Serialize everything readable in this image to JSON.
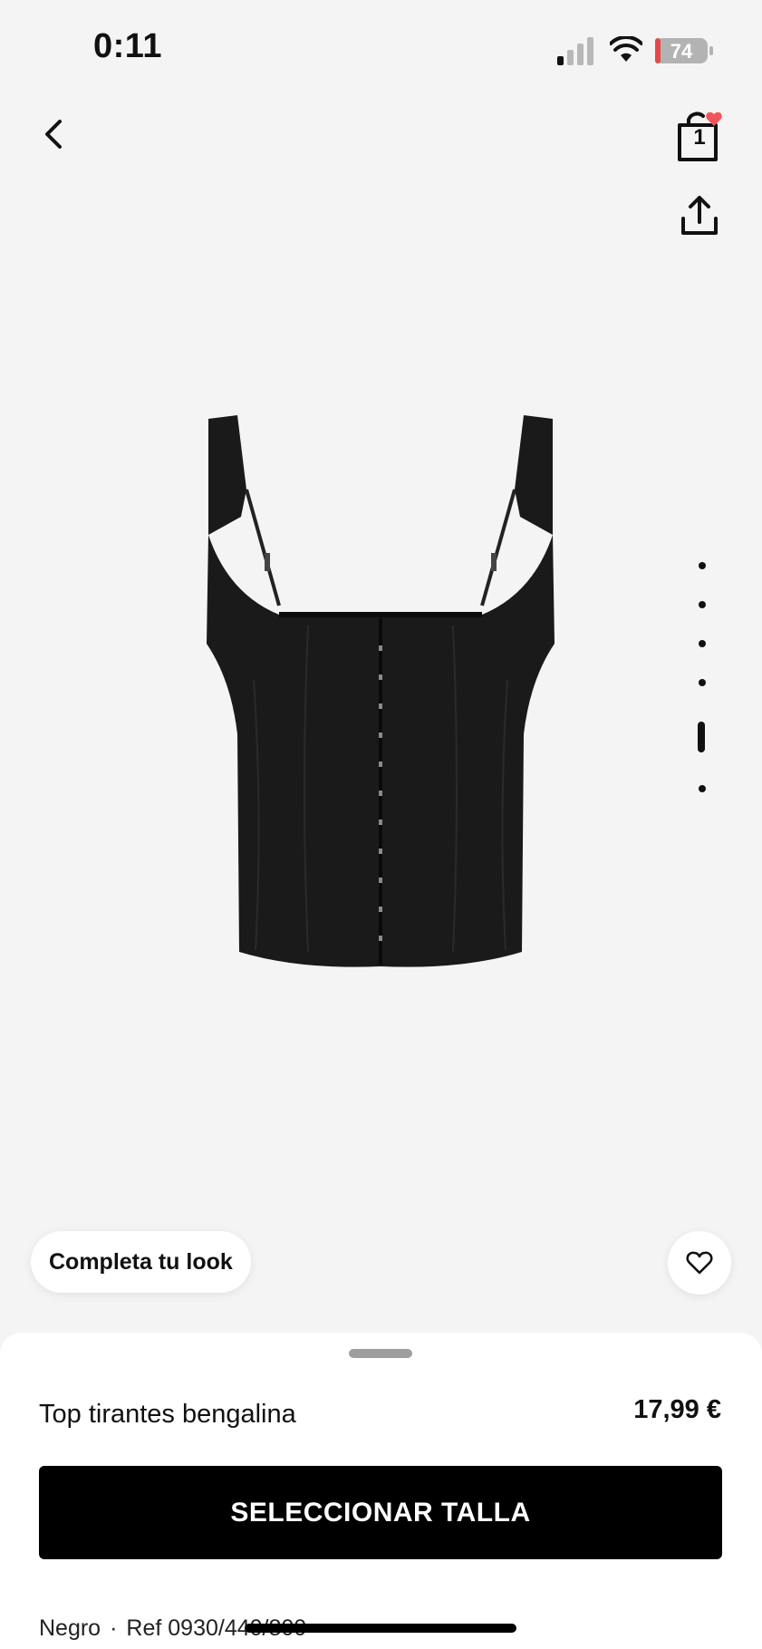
{
  "status_bar": {
    "time": "0:11",
    "battery": "74",
    "icons": [
      "signal-icon",
      "wifi-icon",
      "battery-charging-icon"
    ]
  },
  "nav": {
    "back_icon": "chevron-left-icon",
    "bag_count": "1",
    "bag_icon": "shopping-bag-icon",
    "share_icon": "share-icon"
  },
  "gallery": {
    "image_alt": "Top tirantes bengalina",
    "total_images": 6,
    "active_index": 4
  },
  "floating": {
    "complete_look": "Completa tu look",
    "favorite_icon": "heart-icon"
  },
  "product": {
    "name": "Top tirantes bengalina",
    "price": "17,99 €",
    "cta": "SELECCIONAR TALLA",
    "color": "Negro",
    "separator": "·",
    "ref": "Ref 0930/440/800"
  },
  "colors": {
    "background": "#f4f4f4",
    "cta_bg": "#000000",
    "badge": "#f2545b"
  }
}
